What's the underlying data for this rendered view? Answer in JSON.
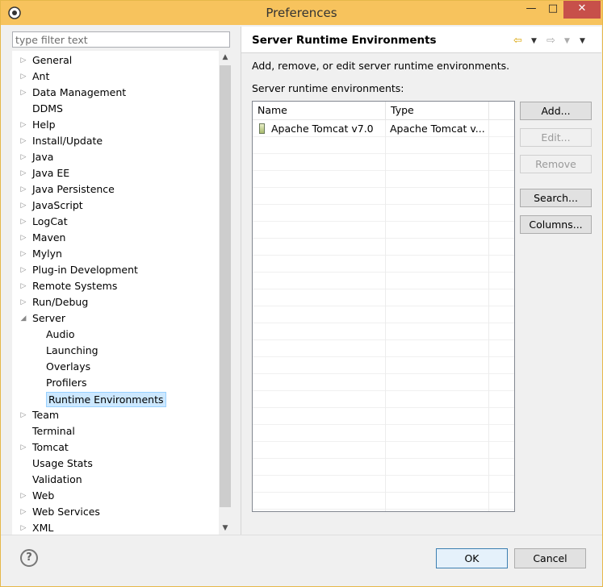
{
  "window": {
    "title": "Preferences",
    "min_label": "—",
    "max_label": "□",
    "close_label": "✕"
  },
  "filter": {
    "placeholder": "type filter text",
    "value": ""
  },
  "tree": [
    {
      "label": "General",
      "arrow": "▷",
      "level": 0
    },
    {
      "label": "Ant",
      "arrow": "▷",
      "level": 0
    },
    {
      "label": "Data Management",
      "arrow": "▷",
      "level": 0
    },
    {
      "label": "DDMS",
      "arrow": "",
      "level": 0
    },
    {
      "label": "Help",
      "arrow": "▷",
      "level": 0
    },
    {
      "label": "Install/Update",
      "arrow": "▷",
      "level": 0
    },
    {
      "label": "Java",
      "arrow": "▷",
      "level": 0
    },
    {
      "label": "Java EE",
      "arrow": "▷",
      "level": 0
    },
    {
      "label": "Java Persistence",
      "arrow": "▷",
      "level": 0
    },
    {
      "label": "JavaScript",
      "arrow": "▷",
      "level": 0
    },
    {
      "label": "LogCat",
      "arrow": "▷",
      "level": 0
    },
    {
      "label": "Maven",
      "arrow": "▷",
      "level": 0
    },
    {
      "label": "Mylyn",
      "arrow": "▷",
      "level": 0
    },
    {
      "label": "Plug-in Development",
      "arrow": "▷",
      "level": 0
    },
    {
      "label": "Remote Systems",
      "arrow": "▷",
      "level": 0
    },
    {
      "label": "Run/Debug",
      "arrow": "▷",
      "level": 0
    },
    {
      "label": "Server",
      "arrow": "◢",
      "level": 0
    },
    {
      "label": "Audio",
      "arrow": "",
      "level": 1
    },
    {
      "label": "Launching",
      "arrow": "",
      "level": 1
    },
    {
      "label": "Overlays",
      "arrow": "",
      "level": 1
    },
    {
      "label": "Profilers",
      "arrow": "",
      "level": 1
    },
    {
      "label": "Runtime Environments",
      "arrow": "",
      "level": 1,
      "selected": true
    },
    {
      "label": "Team",
      "arrow": "▷",
      "level": 0
    },
    {
      "label": "Terminal",
      "arrow": "",
      "level": 0
    },
    {
      "label": "Tomcat",
      "arrow": "▷",
      "level": 0
    },
    {
      "label": "Usage Stats",
      "arrow": "",
      "level": 0
    },
    {
      "label": "Validation",
      "arrow": "",
      "level": 0
    },
    {
      "label": "Web",
      "arrow": "▷",
      "level": 0
    },
    {
      "label": "Web Services",
      "arrow": "▷",
      "level": 0
    },
    {
      "label": "XML",
      "arrow": "▷",
      "level": 0
    }
  ],
  "page": {
    "title": "Server Runtime Environments",
    "description": "Add, remove, or edit server runtime environments.",
    "list_label": "Server runtime environments:",
    "columns": [
      "Name",
      "Type"
    ],
    "rows": [
      {
        "name": "Apache Tomcat v7.0",
        "type": "Apache Tomcat v..."
      }
    ]
  },
  "buttons": {
    "add": "Add...",
    "edit": "Edit...",
    "remove": "Remove",
    "search": "Search...",
    "columns": "Columns..."
  },
  "footer": {
    "help": "?",
    "ok": "OK",
    "cancel": "Cancel"
  },
  "colors": {
    "titlebar": "#f7c35d",
    "selection": "#cce8ff",
    "close": "#c7504a"
  }
}
